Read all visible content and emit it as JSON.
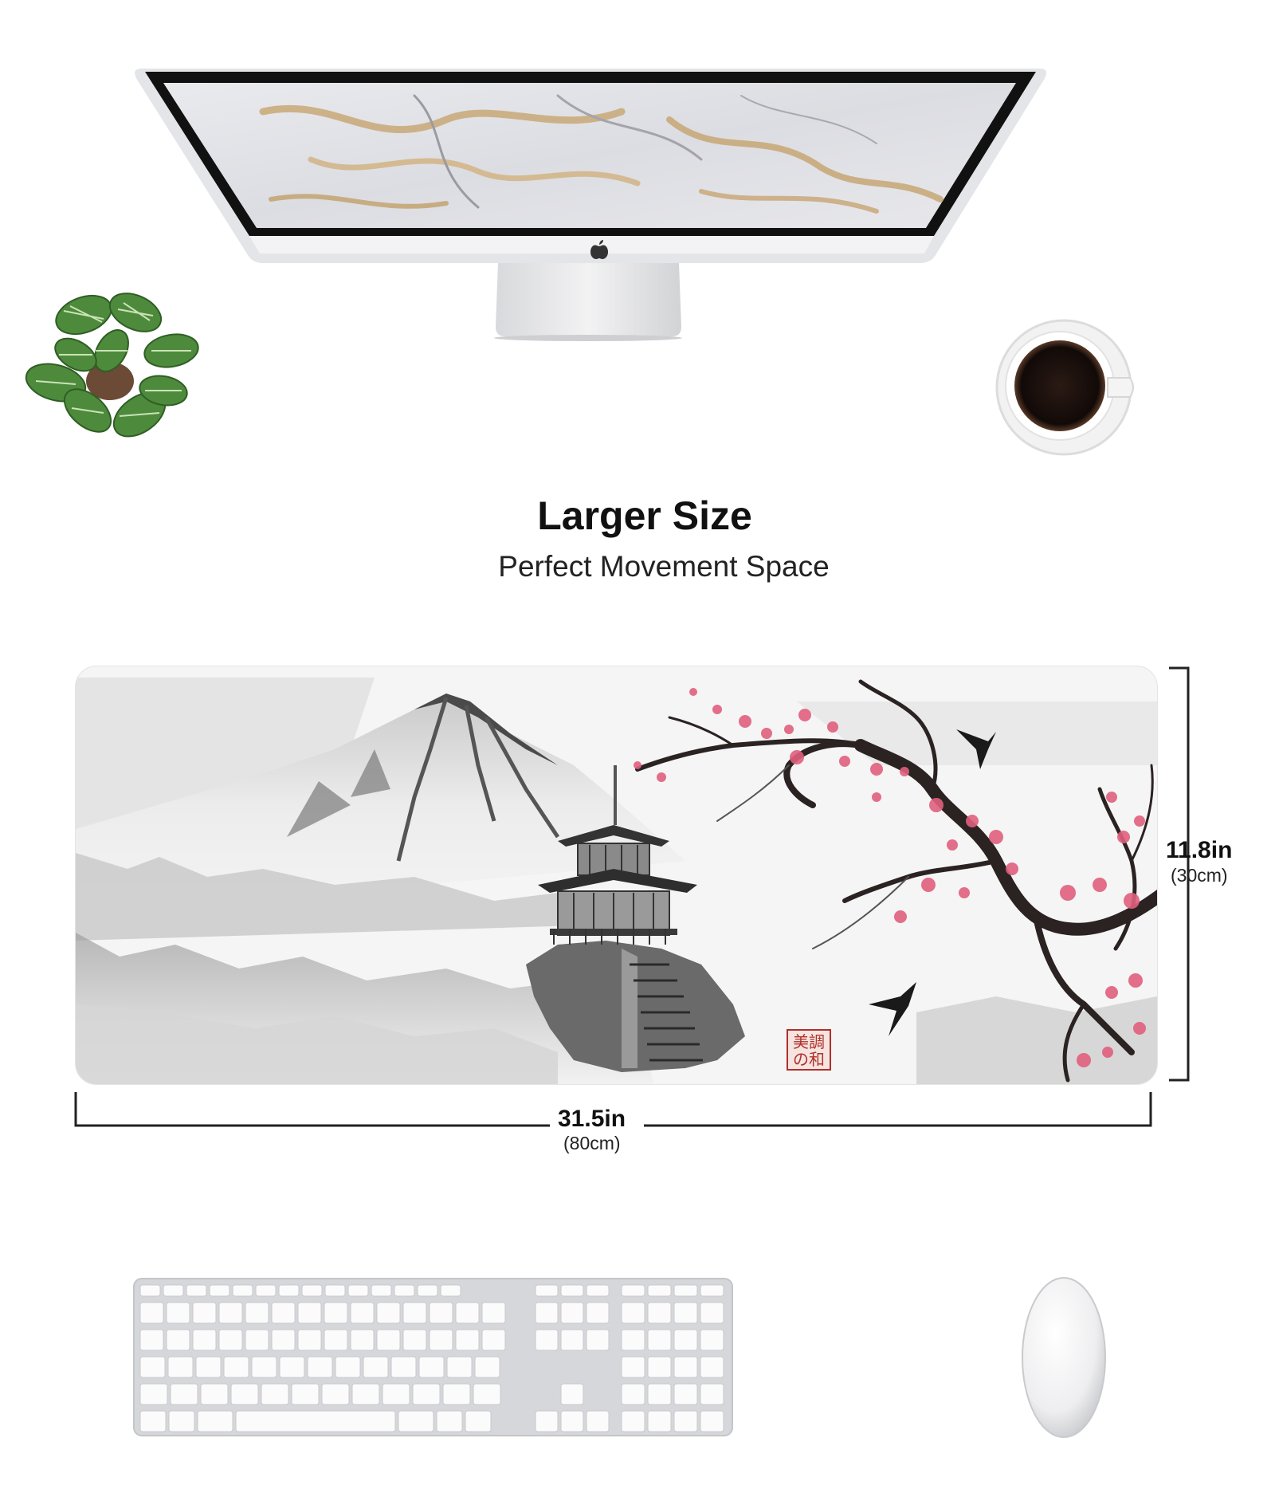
{
  "headline": "Larger Size",
  "subheadline": "Perfect Movement Space",
  "dimensions": {
    "height_in": "11.8in",
    "height_cm": "(30cm)",
    "width_in": "31.5in",
    "width_cm": "(80cm)"
  },
  "stamp_text": "美調の和",
  "colors": {
    "blossom": "#e0607e",
    "ink": "#2b2222",
    "mist": "#d9d9d9",
    "coffee": "#1a1010"
  },
  "icons": [
    "apple-logo-icon",
    "plant-icon",
    "coffee-cup-icon",
    "swallow-icon"
  ]
}
